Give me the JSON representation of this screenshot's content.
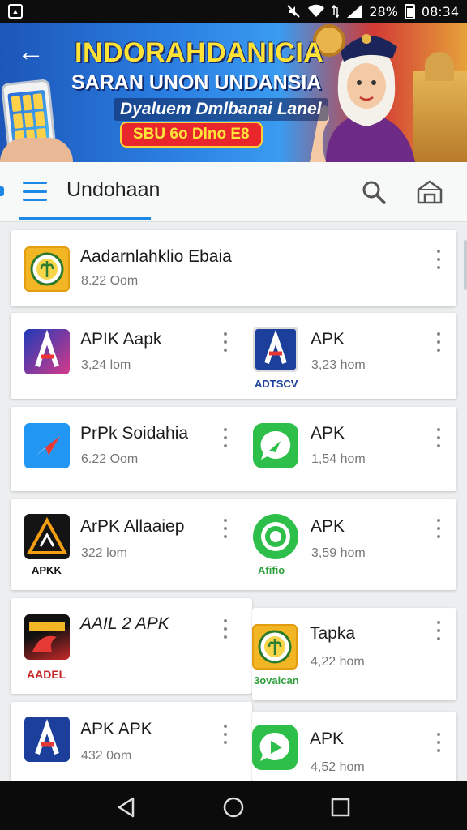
{
  "status_bar": {
    "time": "08:34",
    "battery": "28%",
    "icons": [
      "notification-icon",
      "mute-icon",
      "wifi-icon",
      "data-icon",
      "signal-icon",
      "battery-icon"
    ]
  },
  "banner": {
    "title": "INDORAHDANICIA",
    "subtitle": "SARAN UNON UNDANSIA",
    "tagline": "Dyaluem Dmlbanai Lanel",
    "pill": "SBU 6o Dlno E8",
    "colors": {
      "title": "#ffe236",
      "pill": "#e8262c"
    }
  },
  "app_bar": {
    "title": "Undohaan",
    "accent": "#1e88e5"
  },
  "apps": [
    {
      "name": "Aadarnlahklio Ebaia",
      "size": "8.22 Oom",
      "caption": ""
    },
    {
      "name": "APIK Aapk",
      "size": "3,24 lom",
      "caption": ""
    },
    {
      "name": "APK",
      "size": "3,23 hom",
      "caption": "ADTSCV"
    },
    {
      "name": "PrPk Soidahia",
      "size": "6.22 Oom",
      "caption": ""
    },
    {
      "name": "APK",
      "size": "1,54 hom",
      "caption": ""
    },
    {
      "name": "ArPK Allaaiep",
      "size": "322 lom",
      "caption": "APKK"
    },
    {
      "name": "APK",
      "size": "3,59 hom",
      "caption": "Afifio"
    },
    {
      "name": "AAIL 2 APK",
      "size": "",
      "caption": "AADEL"
    },
    {
      "name": "Tapka",
      "size": "4,22 hom",
      "caption": "3ovaican"
    },
    {
      "name": "APK APK",
      "size": "432 0om",
      "caption": ""
    },
    {
      "name": "APK",
      "size": "4,52 hom",
      "caption": ""
    }
  ],
  "nav": [
    "back-icon",
    "home-icon",
    "recents-icon"
  ]
}
